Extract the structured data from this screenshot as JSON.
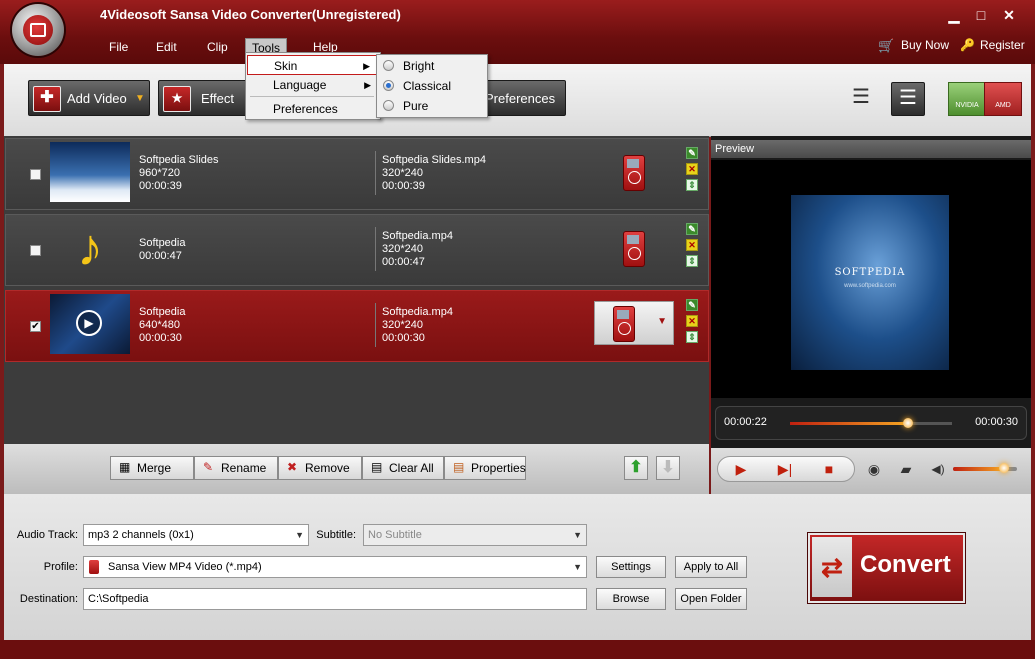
{
  "app": {
    "title": "4Videosoft Sansa Video Converter(Unregistered)"
  },
  "menu": [
    "File",
    "Edit",
    "Clip",
    "Tools",
    "Help"
  ],
  "top_links": {
    "buy_now": "Buy Now",
    "register": "Register"
  },
  "toolbar": {
    "add_video": "Add Video",
    "effect": "Effect",
    "preferences": "Preferences",
    "gpu": [
      "NVIDIA",
      "AMD"
    ]
  },
  "tools_menu": {
    "items": [
      "Skin",
      "Language",
      "Preferences"
    ]
  },
  "skin_menu": {
    "items": [
      "Bright",
      "Classical",
      "Pure"
    ],
    "selected": "Classical"
  },
  "files": [
    {
      "name": "Softpedia Slides",
      "resolution": "960*720",
      "duration": "00:00:39",
      "out_name": "Softpedia Slides.mp4",
      "out_resolution": "320*240",
      "out_duration": "00:00:39",
      "checked": false
    },
    {
      "name": "Softpedia",
      "duration": "00:00:47",
      "out_name": "Softpedia.mp4",
      "out_resolution": "320*240",
      "out_duration": "00:00:47",
      "checked": false
    },
    {
      "name": "Softpedia",
      "resolution": "640*480",
      "duration": "00:00:30",
      "out_name": "Softpedia.mp4",
      "out_resolution": "320*240",
      "out_duration": "00:00:30",
      "checked": true
    }
  ],
  "list_buttons": {
    "merge": "Merge",
    "rename": "Rename",
    "remove": "Remove",
    "clear_all": "Clear All",
    "properties": "Properties"
  },
  "preview": {
    "label": "Preview",
    "current_time": "00:00:22",
    "total_time": "00:00:30",
    "progress": 0.73,
    "frame_text": "SOFTPEDIA",
    "frame_sub": "www.softpedia.com",
    "volume": 0.8
  },
  "settings": {
    "audio_track_label": "Audio Track:",
    "audio_track": "mp3 2 channels (0x1)",
    "subtitle_label": "Subtitle:",
    "subtitle": "No Subtitle",
    "profile_label": "Profile:",
    "profile": "Sansa View MP4 Video (*.mp4)",
    "destination_label": "Destination:",
    "destination": "C:\\Softpedia",
    "settings_btn": "Settings",
    "apply_all_btn": "Apply to All",
    "browse_btn": "Browse",
    "open_folder_btn": "Open Folder",
    "convert_btn": "Convert"
  },
  "colors": {
    "brand": "#8a1414",
    "accent": "#c62828",
    "progress": "#f5a623"
  }
}
